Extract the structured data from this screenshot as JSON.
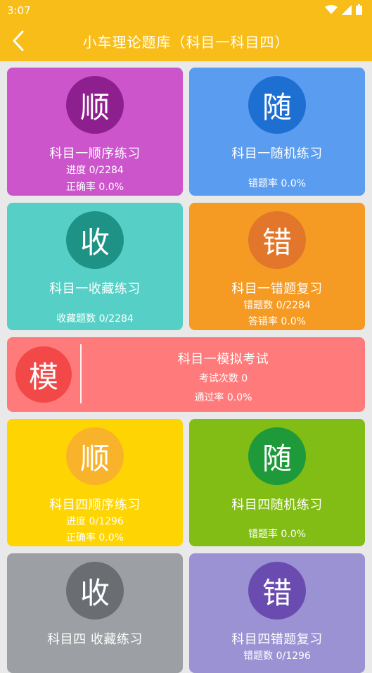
{
  "status": {
    "time": "3:07"
  },
  "appbar": {
    "title": "小车理论题库（科目一科目四）"
  },
  "cards": {
    "k1_seq": {
      "char": "顺",
      "label": "科目一顺序练习",
      "line1": "进度  0/2284",
      "line2": "正确率 0.0%"
    },
    "k1_rand": {
      "char": "随",
      "label": "科目一随机练习",
      "line1": "错题率 0.0%"
    },
    "k1_fav": {
      "char": "收",
      "label": "科目一收藏练习",
      "line1": "收藏题数 0/2284"
    },
    "k1_wrong": {
      "char": "错",
      "label": "科目一错题复习",
      "line1": "错题数 0/2284",
      "line2": "答错率 0.0%"
    },
    "k1_exam": {
      "char": "模",
      "label": "科目一模拟考试",
      "line1": "考试次数 0",
      "line2": "通过率   0.0%"
    },
    "k4_seq": {
      "char": "顺",
      "label": "科目四顺序练习",
      "line1": "进度   0/1296",
      "line2": "正确率 0.0%"
    },
    "k4_rand": {
      "char": "随",
      "label": "科目四随机练习",
      "line1": "错题率 0.0%"
    },
    "k4_fav": {
      "char": "收",
      "label": "科目四 收藏练习"
    },
    "k4_wrong": {
      "char": "错",
      "label": "科目四错题复习",
      "line1": "错题数 0/1296"
    }
  },
  "colors": {
    "appbar": "#f8bd18",
    "purple": "#cc55cc",
    "purple_dark": "#8e1f8e",
    "blue": "#5a9cf0",
    "blue_dark": "#1d6fd1",
    "teal": "#56d0c6",
    "teal_dark": "#1f9286",
    "orange": "#f59a23",
    "orange_dark": "#e2762a",
    "red": "#ff7b7b",
    "red_dark": "#f24848",
    "yellow": "#ffd403",
    "yellow_dark": "#f9b32a",
    "green": "#82bd15",
    "green_dark": "#1e9a3b",
    "gray": "#9c9fa3",
    "gray_dark": "#6a6e72",
    "lavender": "#9b92d4",
    "lavender_dark": "#6a4bb0"
  }
}
